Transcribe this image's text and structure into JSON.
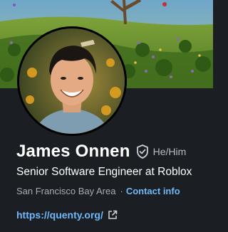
{
  "profile": {
    "name": "James Onnen",
    "pronouns": "He/Him",
    "headline": "Senior Software Engineer at Roblox",
    "location": "San Francisco Bay Area",
    "separator": "·",
    "contact_label": "Contact info",
    "website": "https://quenty.org/"
  },
  "icons": {
    "verified": "shield-check-icon",
    "external_link": "external-link-icon"
  },
  "colors": {
    "background": "#1b1f23",
    "link": "#71b7fb",
    "secondary_text": "#a9adb2"
  }
}
